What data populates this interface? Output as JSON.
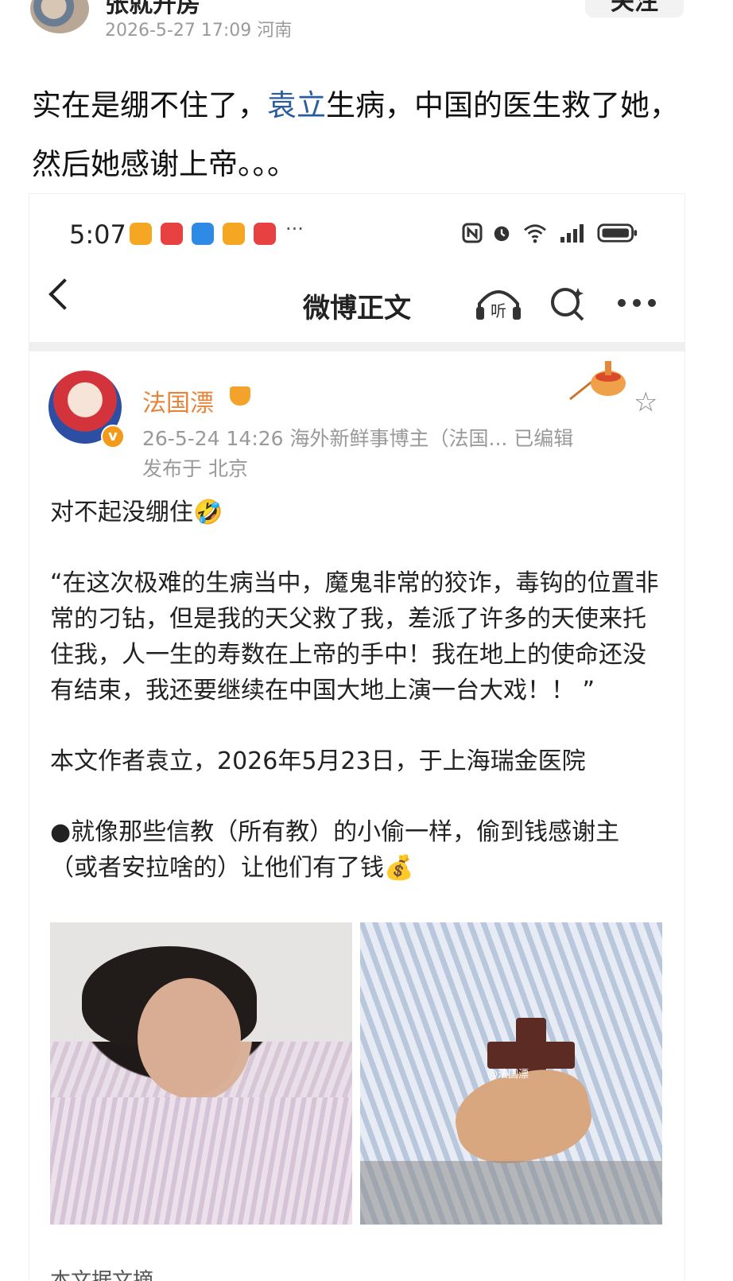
{
  "outer_post": {
    "author": "张就开房",
    "meta": "2026-5-27 17:09  河南",
    "follow_label": "关注",
    "text_before_link": "实在是绷不住了，",
    "link_text": "袁立",
    "text_after_link": "生病，中国的医生救了她，然后她感谢上帝。。。"
  },
  "screenshot": {
    "status_bar": {
      "time": "5:07",
      "app_icon_colors": [
        "#f5a623",
        "#e84141",
        "#2f8ae5",
        "#f5a623",
        "#e84141"
      ],
      "more": "···"
    },
    "nav": {
      "title": "微博正文",
      "listen_icon": "headphones-icon",
      "search_icon": "search-icon",
      "more_icon": "more-icon"
    },
    "post": {
      "author": "法国漂",
      "meta_line1": "26-5-24 14:26  海外新鲜事博主（法国...  已编辑",
      "meta_line2": "发布于 北京",
      "para1": "对不起没绷住🤣",
      "para2": "“在这次极难的生病当中，魔鬼非常的狡诈，毒钩的位置非常的刁钻，但是我的天父救了我，差派了许多的天使来托住我，人一生的寿数在上帝的手中！我在地上的使命还没有结束，我还要继续在中国大地上演一台大戏！！ ”",
      "para3": "本文作者袁立，2026年5月23日，于上海瑞金医院",
      "para4": "●就像那些信教（所有教）的小偷一样，偷到钱感谢主（或者安拉啥的）让他们有了钱💰",
      "photo2_watermark": "@法国漂",
      "bottom_partial": "本文据文摘"
    }
  }
}
